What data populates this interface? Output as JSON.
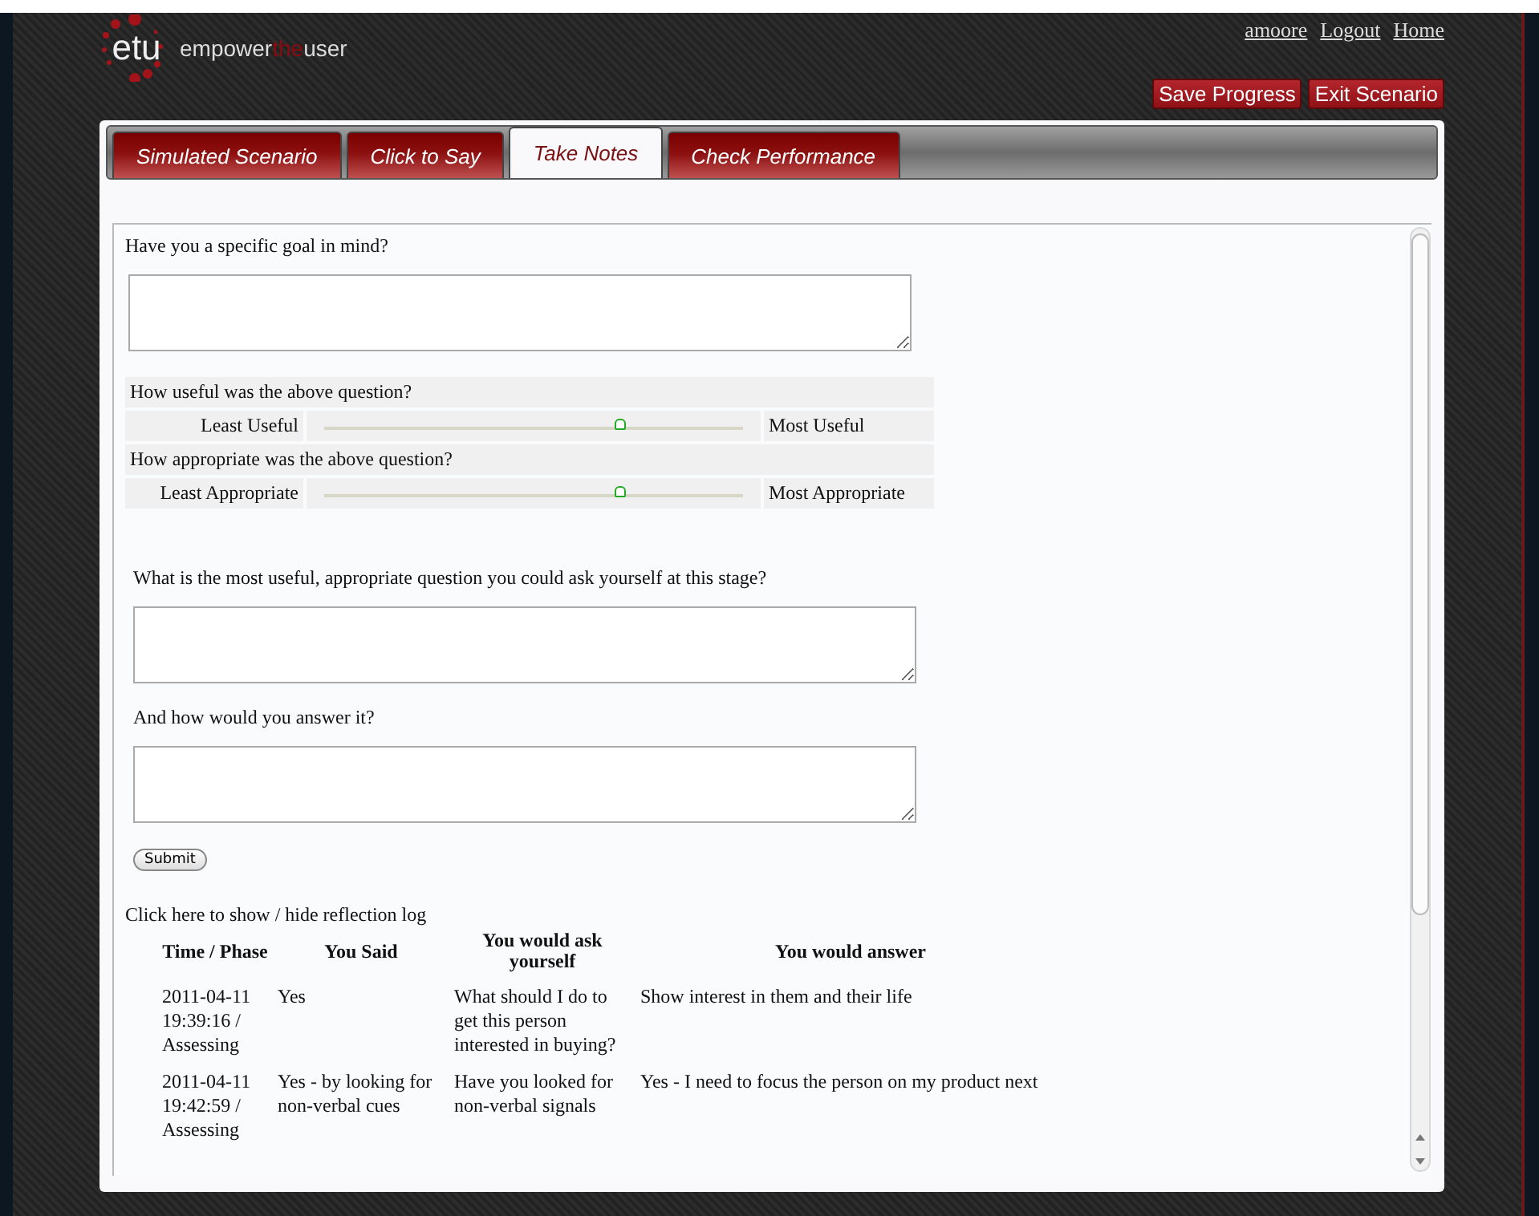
{
  "logo": {
    "mark": "etu",
    "parts": [
      {
        "text": "empower",
        "kind": "plain"
      },
      {
        "text": "the",
        "kind": "accent"
      },
      {
        "text": "user",
        "kind": "plain"
      }
    ]
  },
  "top_links": [
    "amoore",
    "Logout",
    "Home"
  ],
  "action_buttons": [
    "Save Progress",
    "Exit Scenario"
  ],
  "tabs": [
    {
      "label": "Simulated Scenario",
      "selected": false
    },
    {
      "label": "Click to Say",
      "selected": false
    },
    {
      "label": "Take Notes",
      "selected": true
    },
    {
      "label": "Check Performance",
      "selected": false
    }
  ],
  "goal_question": "Have you a specific goal in mind?",
  "ratings": [
    {
      "question": "How useful was the above question?",
      "min_label": "Least Useful",
      "max_label": "Most Useful",
      "level": 0.71
    },
    {
      "question": "How appropriate was the above question?",
      "min_label": "Least Appropriate",
      "max_label": "Most Appropriate",
      "level": 0.71
    }
  ],
  "self_question": "What is the most useful, appropriate question you could ask yourself at this stage?",
  "answer_question": "And how would you answer it?",
  "submit_button": "Submit",
  "log_toggle": "Click here to show / hide reflection log",
  "log_table": {
    "columns": [
      "Time / Phase",
      "You Said",
      "You would ask yourself",
      "You would answer"
    ],
    "rows": [
      [
        "2011-04-11 19:39:16 / Assessing",
        "Yes",
        "What should I do to get this person interested in buying?",
        "Show interest in them and their life"
      ],
      [
        "2011-04-11 19:42:59 / Assessing",
        "Yes - by looking for non-verbal cues",
        "Have you looked for non-verbal signals",
        "Yes - I need to focus the person on my product next"
      ]
    ]
  }
}
